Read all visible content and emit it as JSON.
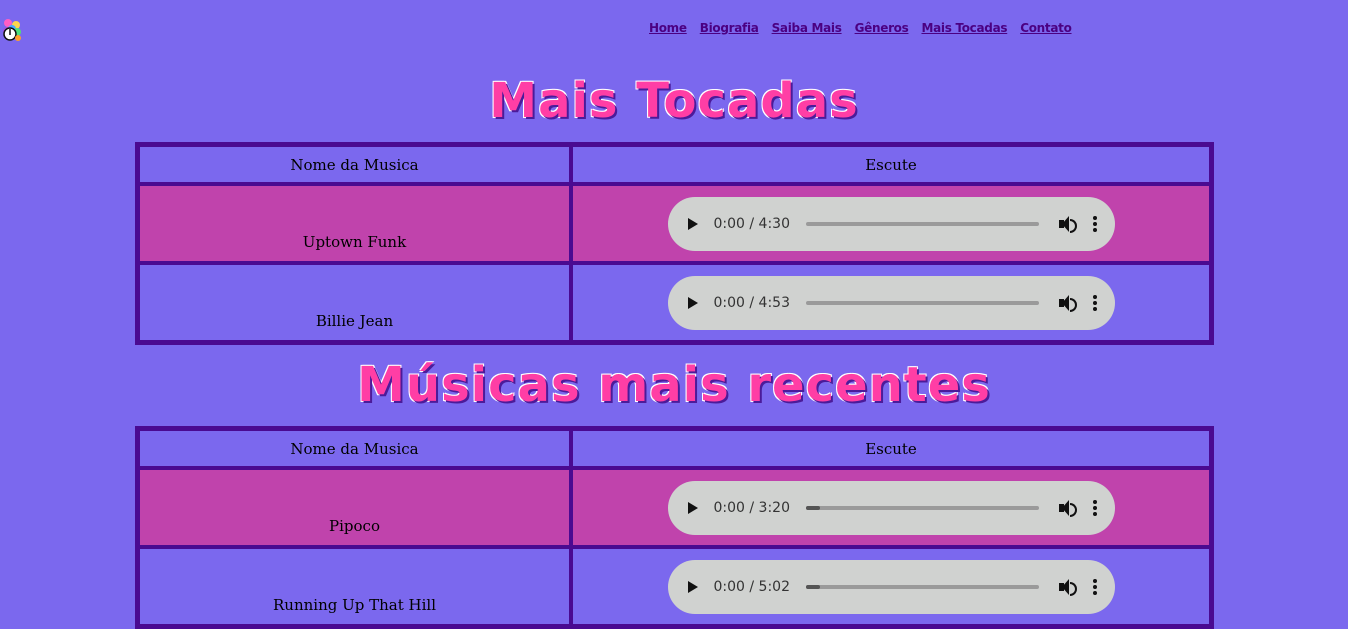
{
  "nav": {
    "items": [
      "Home",
      "Biografia",
      "Saiba Mais",
      "Gêneros",
      "Mais Tocadas",
      "Contato"
    ]
  },
  "sections": [
    {
      "title": "Mais Tocadas",
      "headers": [
        "Nome da Musica",
        "Escute"
      ],
      "rows": [
        {
          "name": "Uptown Funk",
          "time": "0:00 / 4:30",
          "progress": 0
        },
        {
          "name": "Billie Jean",
          "time": "0:00 / 4:53",
          "progress": 0
        }
      ]
    },
    {
      "title": "Músicas mais recentes",
      "headers": [
        "Nome da Musica",
        "Escute"
      ],
      "rows": [
        {
          "name": "Pipoco",
          "time": "0:00 / 3:20",
          "progress": 0
        },
        {
          "name": "Running Up That Hill",
          "time": "0:00 / 5:02",
          "progress": 0
        }
      ]
    }
  ],
  "colors": {
    "background": "#7b68ee",
    "row_pink": "#c043ac",
    "border": "#4a0a91",
    "title": "#ff3ea5",
    "nav_link": "#4b0082"
  }
}
